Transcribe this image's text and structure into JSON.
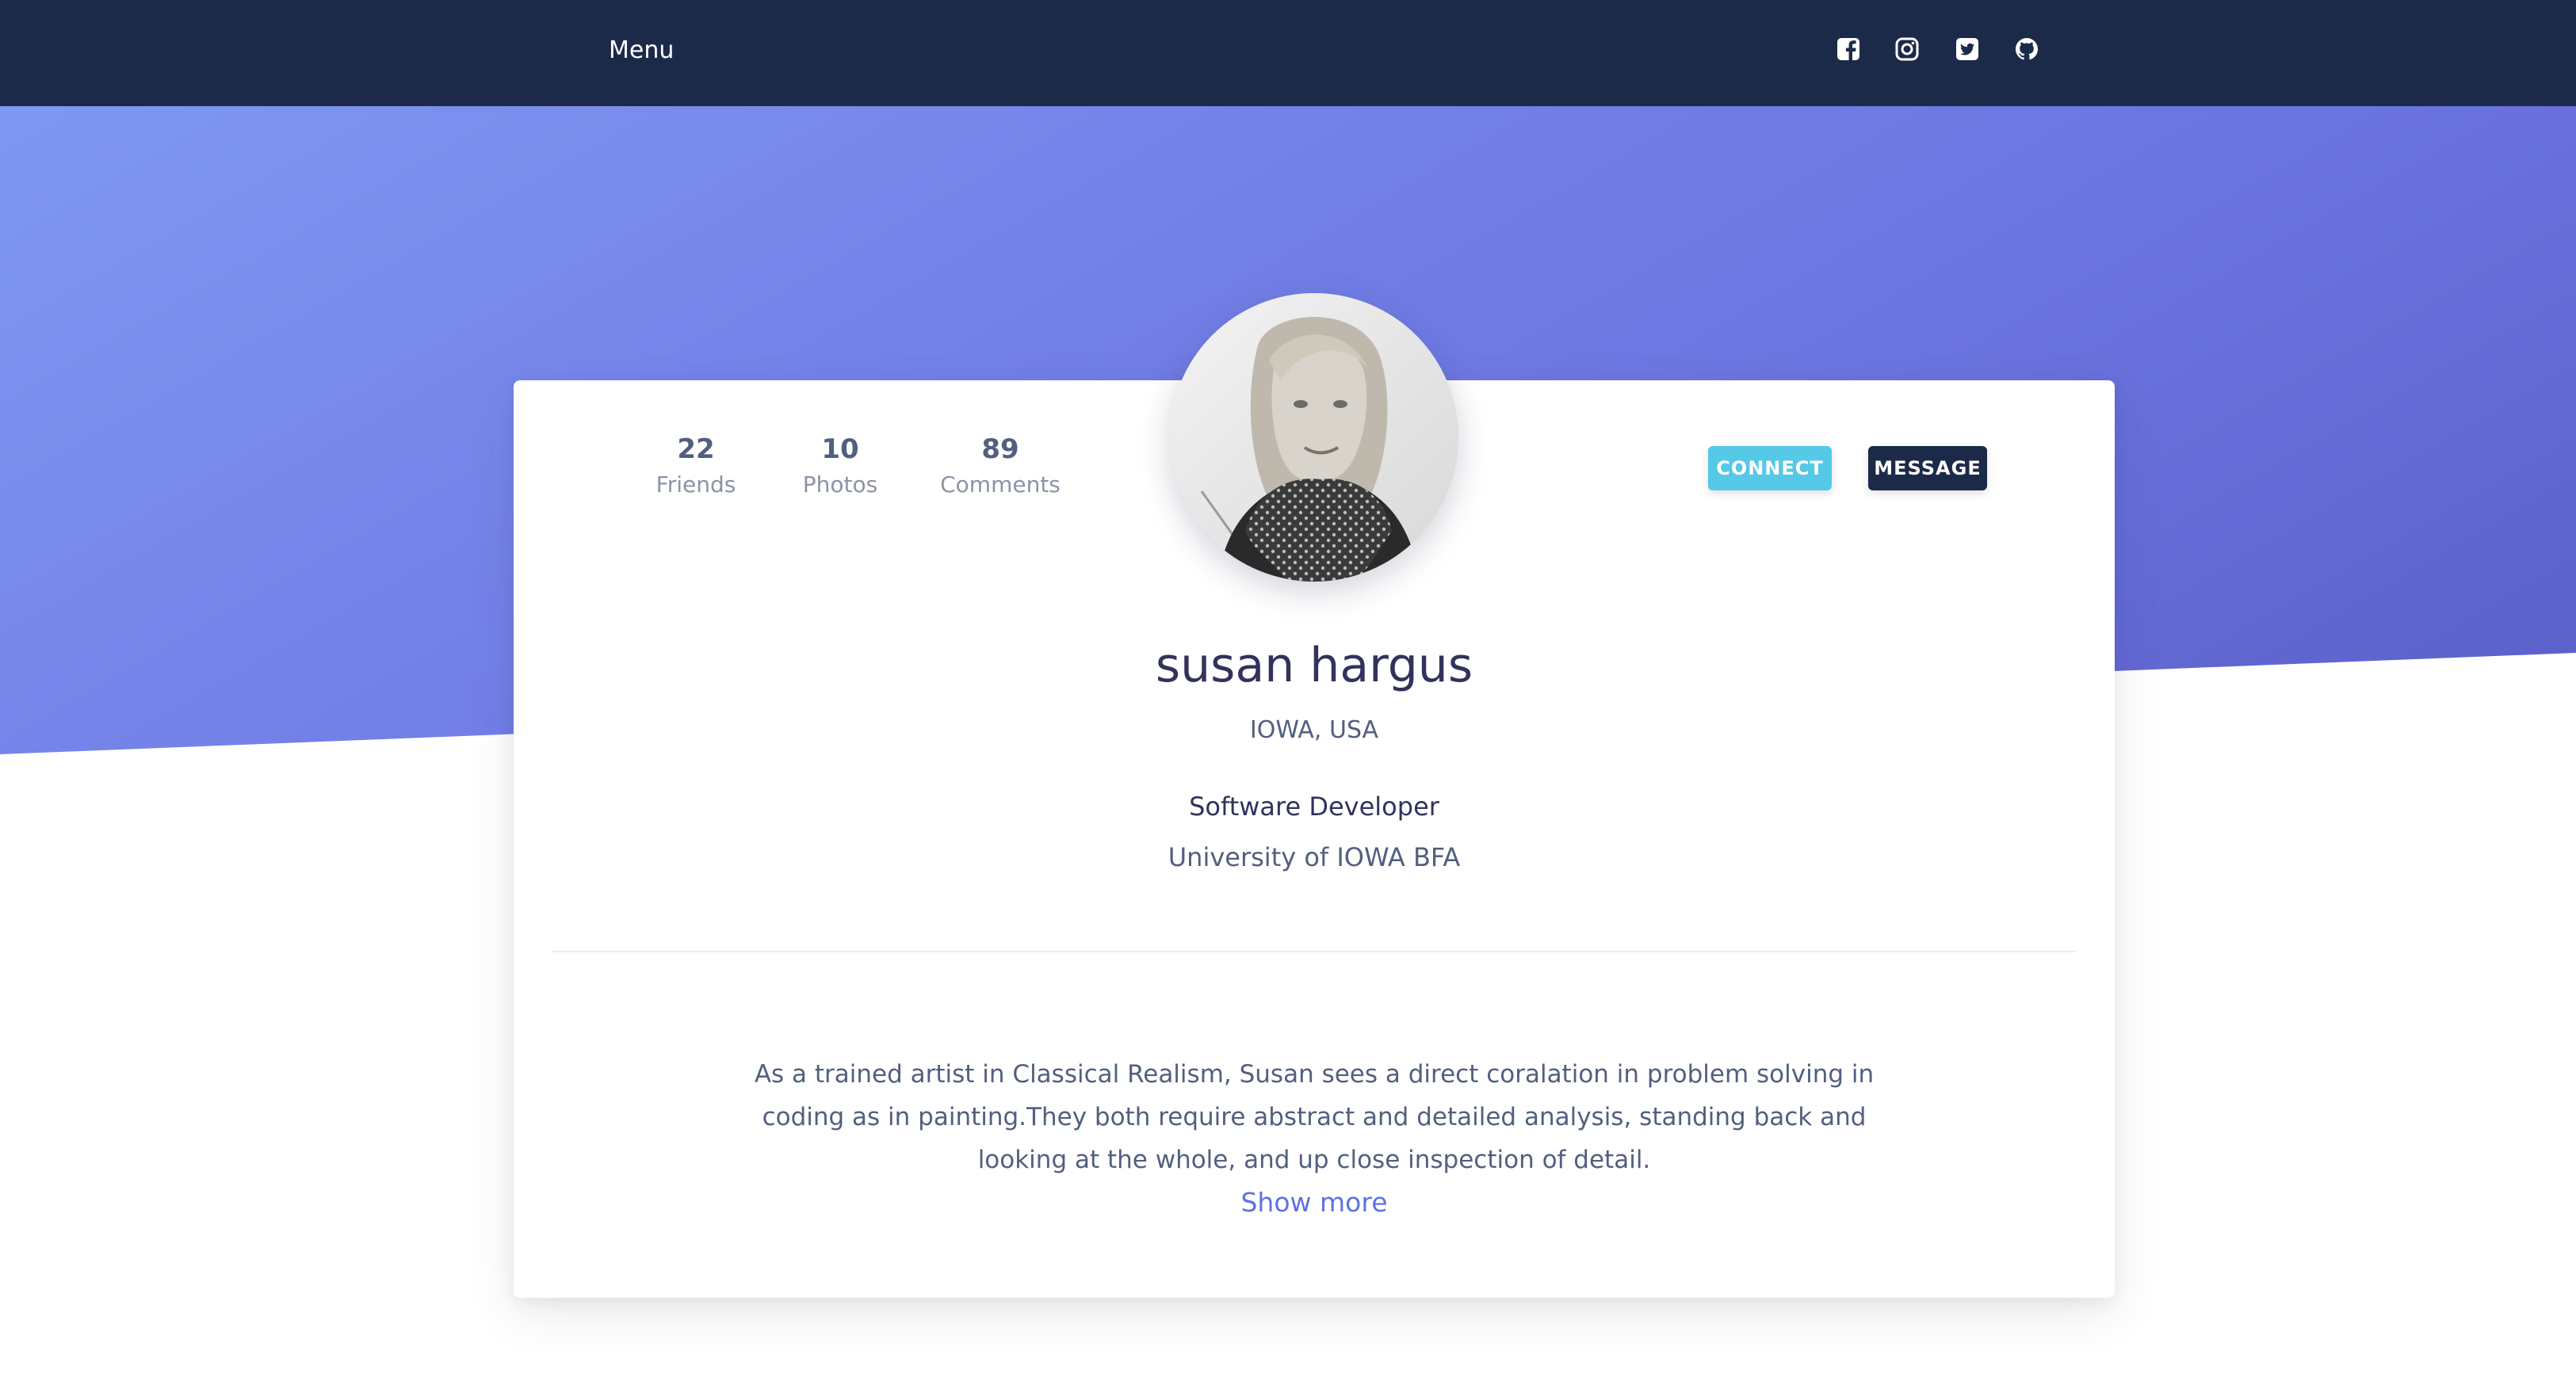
{
  "nav": {
    "menu_label": "Menu",
    "social_icons": [
      "facebook-square-icon",
      "instagram-icon",
      "twitter-square-icon",
      "github-icon"
    ]
  },
  "profile": {
    "stats": [
      {
        "value": "22",
        "label": "Friends"
      },
      {
        "value": "10",
        "label": "Photos"
      },
      {
        "value": "89",
        "label": "Comments"
      }
    ],
    "connect_label": "CONNECT",
    "message_label": "MESSAGE",
    "name": "susan hargus",
    "location": "IOWA, USA",
    "job_title": "Software Developer",
    "education": "University of IOWA BFA",
    "bio": "As a trained artist in Classical Realism, Susan sees a direct coralation in problem solving in coding as in painting.They both require abstract and detailed analysis, standing back and looking at the whole, and up close inspection of detail.",
    "show_more_label": "Show more"
  },
  "colors": {
    "navbar": "#1c2a4a",
    "hero_gradient_start": "#7f98f1",
    "hero_gradient_end": "#5a5fc8",
    "connect_button": "#55c9e6",
    "message_button": "#1c2a4a",
    "link": "#5e72e4"
  }
}
